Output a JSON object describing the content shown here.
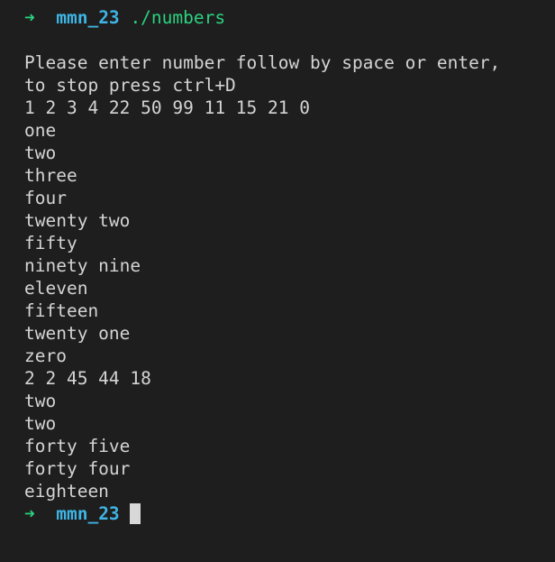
{
  "prompt": {
    "arrow": "➜",
    "directory": "mmn_23",
    "command": "./numbers"
  },
  "output": {
    "message_line1": "Please enter number follow by space or enter,",
    "message_line2": "to stop press ctrl+D",
    "input1": "1 2 3 4 22 50 99 11 15 21 0",
    "words1": [
      "one",
      "two",
      "three",
      "four",
      "twenty two",
      "fifty",
      "ninety nine",
      "eleven",
      "fifteen",
      "twenty one",
      "zero"
    ],
    "input2": "2 2 45 44 18",
    "words2": [
      "two",
      "two",
      "forty five",
      "forty four",
      "eighteen"
    ]
  },
  "colors": {
    "background": "#1e1e1e",
    "text": "#d4d4d4",
    "prompt_arrow": "#2bd27f",
    "prompt_dir": "#3eb5e5",
    "prompt_cmd": "#2bd27f",
    "cursor": "#d8d8d8"
  }
}
